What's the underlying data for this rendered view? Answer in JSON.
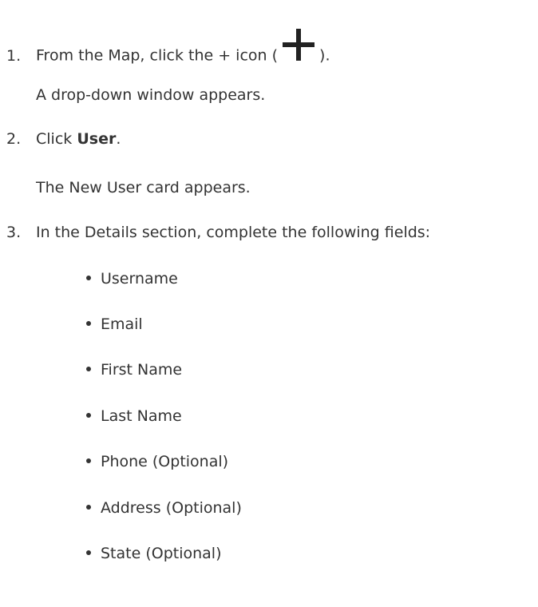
{
  "steps": [
    {
      "number": "1.",
      "text_before": "From the Map, click the + icon (",
      "icon": "plus-icon",
      "text_after": ").",
      "result": "A drop-down window appears."
    },
    {
      "number": "2.",
      "text_before": "Click ",
      "bold": "User",
      "text_after": ".",
      "result": "The New User card appears."
    },
    {
      "number": "3.",
      "text": "In the Details section, complete the following fields:",
      "fields": [
        "Username",
        "Email",
        "First Name",
        "Last Name",
        "Phone (Optional)",
        "Address (Optional)",
        "State (Optional)"
      ]
    }
  ],
  "colors": {
    "text": "#333333",
    "icon": "#222222"
  }
}
